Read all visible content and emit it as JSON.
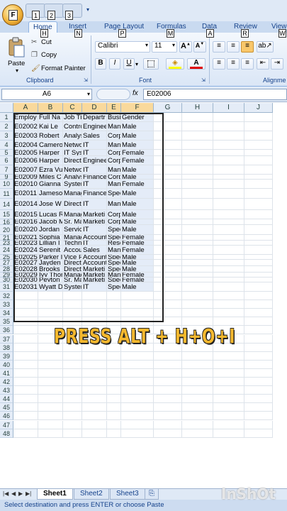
{
  "keytips": {
    "office": "F",
    "qat": [
      "1",
      "2",
      "3"
    ],
    "home": "H",
    "insert": "N",
    "page_layout": "P",
    "formulas": "M",
    "data": "A",
    "review": "R",
    "view": "W"
  },
  "tabs": [
    "Home",
    "Insert",
    "Page Layout",
    "Formulas",
    "Data",
    "Review",
    "View"
  ],
  "ribbon": {
    "paste": "Paste",
    "cut": "Cut",
    "copy": "Copy",
    "format_painter": "Format Painter",
    "clipboard_label": "Clipboard",
    "font_label": "Font",
    "alignment_label": "Alignme",
    "font_name": "Calibri",
    "font_size": "11",
    "grow": "A",
    "shrink": "A",
    "bold": "B",
    "italic": "I",
    "underline": "U",
    "font_color": "A"
  },
  "formula_bar": {
    "name_box": "A6",
    "fx": "fx",
    "value": "E02006"
  },
  "columns": [
    "A",
    "B",
    "C",
    "D",
    "E",
    "F",
    "G",
    "H",
    "I",
    "J"
  ],
  "rows": [
    {
      "n": "1",
      "cells": [
        "Employ",
        "Full Na",
        "Job Title",
        "Departr",
        "Busi",
        "Gender"
      ]
    },
    {
      "n": "2",
      "cells": [
        "E02002",
        "Kai Le",
        "Controls",
        "Enginee",
        "Man",
        "Male"
      ]
    },
    {
      "n": "3",
      "cells": [
        "E02003",
        "Robert",
        "Analyst",
        "Sales",
        "Corp",
        "Male"
      ]
    },
    {
      "n": "4",
      "cells": [
        "E02004",
        "Camero",
        "Network",
        "IT",
        "Man",
        "Male"
      ]
    },
    {
      "n": "5",
      "cells": [
        "E02005",
        "Harper",
        "IT Syster",
        "IT",
        "Corp",
        "Female"
      ]
    },
    {
      "n": "6",
      "cells": [
        "E02006",
        "Harper",
        "Director",
        "Enginee",
        "Corp",
        "Female"
      ]
    },
    {
      "n": "7",
      "cells": [
        "E02007",
        "Ezra Vu",
        "Network",
        "IT",
        "Man",
        "Male"
      ]
    },
    {
      "n": "9",
      "cells": [
        "E02009",
        "Miles C",
        "Analyst I",
        "Finance",
        "Corp",
        "Male"
      ]
    },
    {
      "n": "10",
      "cells": [
        "E02010",
        "Gianna",
        "System A",
        "IT",
        "Man",
        "Female"
      ]
    },
    {
      "n": "11",
      "cells": [
        "E02011",
        "Jameso",
        "Manage",
        "Finance",
        "Spec",
        "Male"
      ]
    },
    {
      "n": "14",
      "cells": [
        "E02014",
        "Jose W",
        "Director",
        "IT",
        "Man",
        "Male"
      ]
    },
    {
      "n": "15",
      "cells": [
        "E02015",
        "Lucas R",
        "Manage",
        "Marketi",
        "Corp",
        "Male"
      ]
    },
    {
      "n": "16",
      "cells": [
        "E02016",
        "Jacob M",
        "Sr. Mana",
        "Marketi",
        "Corp",
        "Male"
      ]
    },
    {
      "n": "20",
      "cells": [
        "E02020",
        "Jordan",
        "Service I",
        "IT",
        "Spec",
        "Male"
      ]
    },
    {
      "n": "21",
      "cells": [
        "E02021",
        "Sophia",
        "Manage",
        "Account",
        "Spec",
        "Female"
      ]
    },
    {
      "n": "23",
      "cells": [
        "E02023",
        "Lillian I",
        "Technica",
        "IT",
        "Rese",
        "Female"
      ]
    },
    {
      "n": "24",
      "cells": [
        "E02024",
        "Serenit",
        "Account",
        "Sales",
        "Man",
        "Female"
      ]
    },
    {
      "n": "25",
      "cells": [
        "E02025",
        "Parker I",
        "Vice Pres",
        "Account",
        "Spec",
        "Male"
      ]
    },
    {
      "n": "27",
      "cells": [
        "E02027",
        "Jayden",
        "Director",
        "Account",
        "Spec",
        "Male"
      ]
    },
    {
      "n": "28",
      "cells": [
        "E02028",
        "Brooks",
        "Director",
        "Marketi",
        "Spec",
        "Male"
      ]
    },
    {
      "n": "29",
      "cells": [
        "E02029",
        "Ivy Thor",
        "Manage",
        "Marketi",
        "Man",
        "Female"
      ]
    },
    {
      "n": "30",
      "cells": [
        "E02030",
        "Peyton",
        "Sr. Mana",
        "Marketi",
        "Spec",
        "Female"
      ]
    },
    {
      "n": "31",
      "cells": [
        "E02031",
        "Wyatt D",
        "System A",
        "IT",
        "Spec",
        "Male"
      ]
    }
  ],
  "empty_rows": [
    "32",
    "33",
    "34",
    "35",
    "36",
    "37",
    "38",
    "39",
    "40",
    "41",
    "42",
    "43",
    "44",
    "45",
    "46",
    "47",
    "48"
  ],
  "overlay_text": "PRESS ALT + H+O+I",
  "sheets": [
    "Sheet1",
    "Sheet2",
    "Sheet3"
  ],
  "status": "Select destination and press ENTER or choose Paste",
  "watermark": "InShOt"
}
